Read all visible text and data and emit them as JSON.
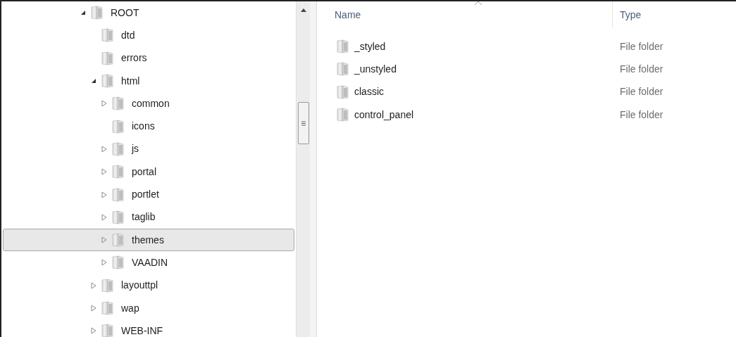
{
  "tree": [
    {
      "label": "ROOT",
      "kind": "branch",
      "expanded": true,
      "selected": false,
      "children": [
        {
          "label": "dtd",
          "kind": "leaf",
          "selected": false
        },
        {
          "label": "errors",
          "kind": "leaf",
          "selected": false
        },
        {
          "label": "html",
          "kind": "branch",
          "expanded": true,
          "selected": false,
          "children": [
            {
              "label": "common",
              "kind": "branch",
              "expanded": false,
              "selected": false
            },
            {
              "label": "icons",
              "kind": "leaf",
              "selected": false
            },
            {
              "label": "js",
              "kind": "branch",
              "expanded": false,
              "selected": false
            },
            {
              "label": "portal",
              "kind": "branch",
              "expanded": false,
              "selected": false
            },
            {
              "label": "portlet",
              "kind": "branch",
              "expanded": false,
              "selected": false
            },
            {
              "label": "taglib",
              "kind": "branch",
              "expanded": false,
              "selected": false
            },
            {
              "label": "themes",
              "kind": "branch",
              "expanded": false,
              "selected": true
            },
            {
              "label": "VAADIN",
              "kind": "branch",
              "expanded": false,
              "selected": false
            }
          ]
        },
        {
          "label": "layouttpl",
          "kind": "branch",
          "expanded": false,
          "selected": false
        },
        {
          "label": "wap",
          "kind": "branch",
          "expanded": false,
          "selected": false
        },
        {
          "label": "WEB-INF",
          "kind": "branch",
          "expanded": false,
          "selected": false
        }
      ]
    }
  ],
  "list": {
    "columns": [
      "Name",
      "Type"
    ],
    "rows": [
      {
        "name": "_styled",
        "type": "File folder"
      },
      {
        "name": "_unstyled",
        "type": "File folder"
      },
      {
        "name": "classic",
        "type": "File folder"
      },
      {
        "name": "control_panel",
        "type": "File folder"
      }
    ]
  }
}
